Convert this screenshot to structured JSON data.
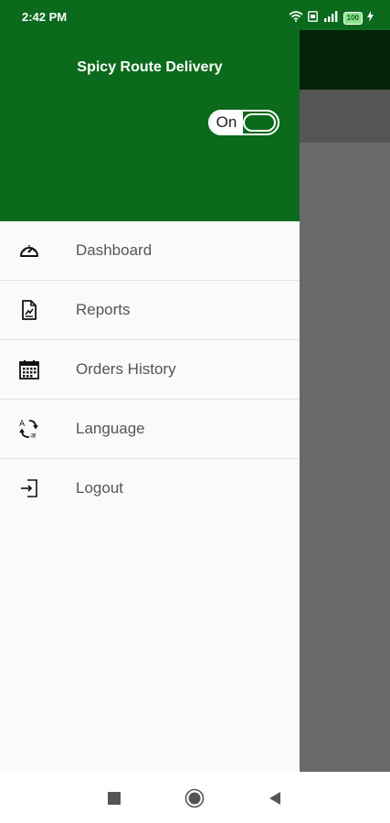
{
  "status_bar": {
    "time": "2:42 PM",
    "battery": "100",
    "icons": [
      "wifi-icon",
      "sim-icon",
      "signal-icon",
      "battery-icon",
      "charging-icon"
    ]
  },
  "drawer": {
    "title": "Spicy Route Delivery",
    "toggle": {
      "label": "On",
      "state": true
    },
    "menu": [
      {
        "label": "Dashboard",
        "icon": "dashboard-icon"
      },
      {
        "label": "Reports",
        "icon": "reports-icon"
      },
      {
        "label": "Orders History",
        "icon": "calendar-icon"
      },
      {
        "label": "Language",
        "icon": "language-icon"
      },
      {
        "label": "Logout",
        "icon": "logout-icon"
      }
    ]
  },
  "nav_bar": {
    "buttons": [
      "recents-button",
      "home-button",
      "back-button"
    ]
  },
  "colors": {
    "primary": "#0b6a1c",
    "drawer_bg": "#fafafa",
    "overlay": "#6a6a6a"
  }
}
